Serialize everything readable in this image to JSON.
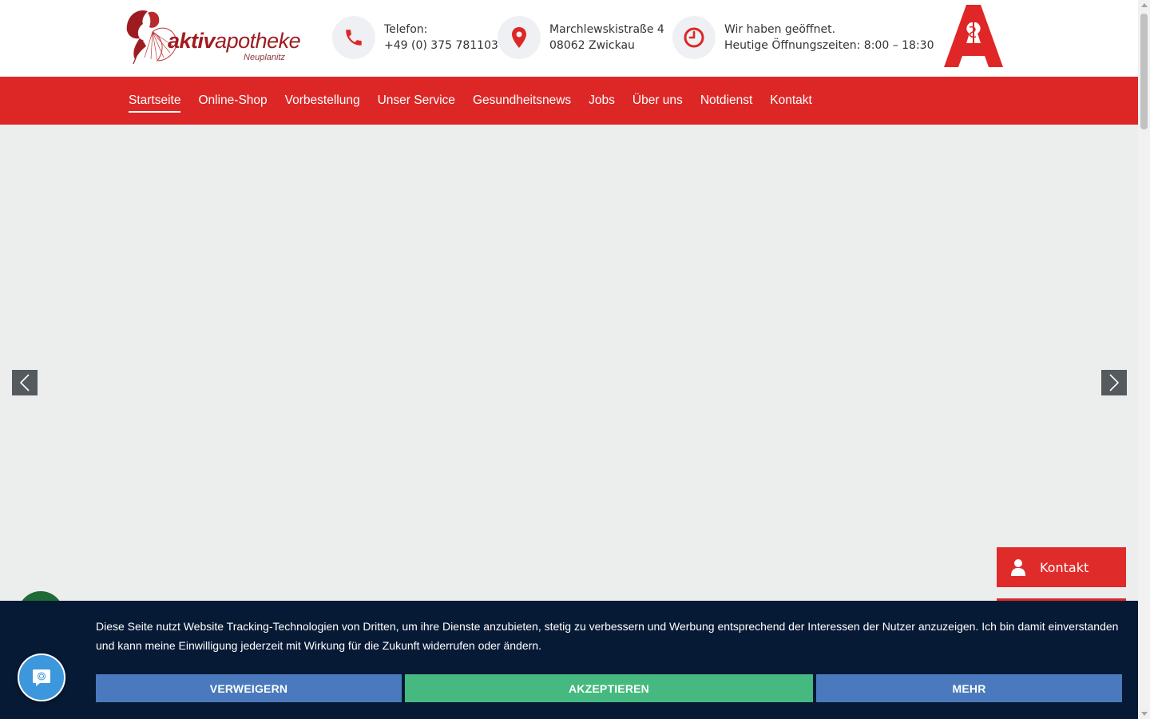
{
  "brand": {
    "logo_bold": "aktiv",
    "logo_light": "apotheke",
    "logo_sub": "Neuplanitz",
    "primary_color": "#dd2727",
    "logo_color": "#9e1c20"
  },
  "contact": {
    "phone_label": "Telefon:",
    "phone_value": "+49 (0) 375 781103",
    "phone_icon": "phone-icon",
    "address_line1": "Marchlewskistraße 4",
    "address_line2": "08062 Zwickau",
    "address_icon": "map-pin-icon",
    "hours_line1": "Wir haben geöffnet.",
    "hours_line2": "Heutige Öffnungszeiten: 8:00 – 18:30",
    "hours_icon": "clock-icon"
  },
  "nav": {
    "items": [
      {
        "label": "Startseite",
        "active": true
      },
      {
        "label": "Online-Shop"
      },
      {
        "label": "Vorbestellung"
      },
      {
        "label": "Unser Service"
      },
      {
        "label": "Gesundheitsnews"
      },
      {
        "label": "Jobs"
      },
      {
        "label": "Über uns"
      },
      {
        "label": "Notdienst"
      },
      {
        "label": "Kontakt"
      }
    ]
  },
  "slider": {
    "prev_icon": "chevron-left-icon",
    "next_icon": "chevron-right-icon"
  },
  "floating": {
    "kontakt_label": "Kontakt",
    "kontakt_icon": "user-icon"
  },
  "cookie": {
    "text": "Diese Seite nutzt Website Tracking-Technologien von Dritten, um ihre Dienste anzubieten, stetig zu verbessern und Werbung entsprechend der Interessen der Nutzer anzuzeigen. Ich bin damit einverstanden und kann meine Einwilligung jederzeit mit Wirkung für die Zukunft widerrufen oder ändern.",
    "refuse_label": "VERWEIGERN",
    "accept_label": "AKZEPTIEREN",
    "more_label": "MEHR",
    "refuse_color": "#4a7abd",
    "accept_color": "#45b97f",
    "banner_color": "#071a35"
  }
}
